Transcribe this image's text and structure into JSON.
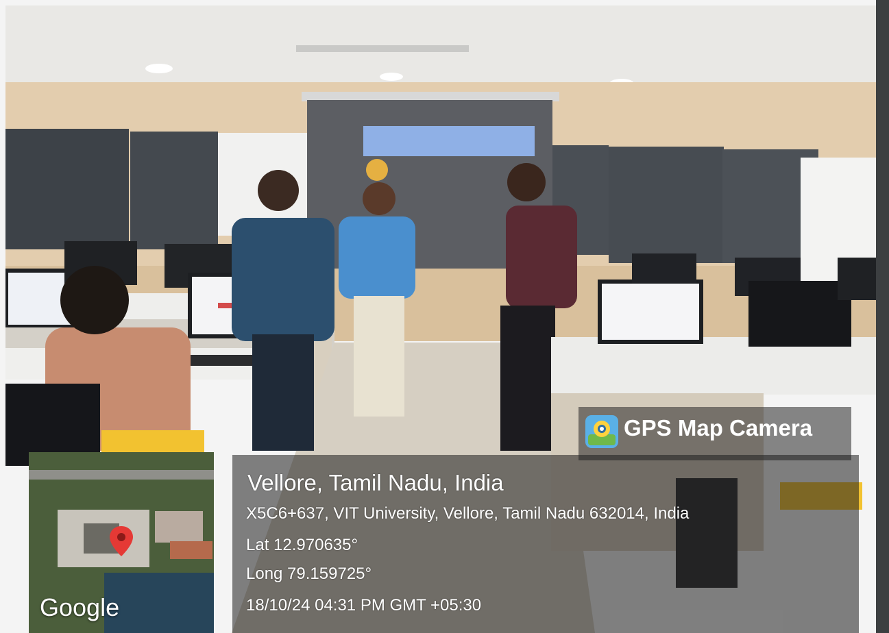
{
  "gps": {
    "app_name": "GPS Map Camera",
    "place": "Vellore, Tamil Nadu, India",
    "address": "X5C6+637, VIT University, Vellore, Tamil Nadu 632014, India",
    "latitude": "Lat 12.970635°",
    "longitude": "Long 79.159725°",
    "datetime": "18/10/24 04:31 PM GMT +05:30"
  },
  "map": {
    "logo_text": "Google",
    "pin_color": "#e53935"
  },
  "colors": {
    "wall": "#e8d2b4",
    "ceiling": "#ecebe8",
    "floor": "#d9d3c8",
    "screen": "#e4e6ea",
    "badge_bg": "#2b2b2b"
  }
}
